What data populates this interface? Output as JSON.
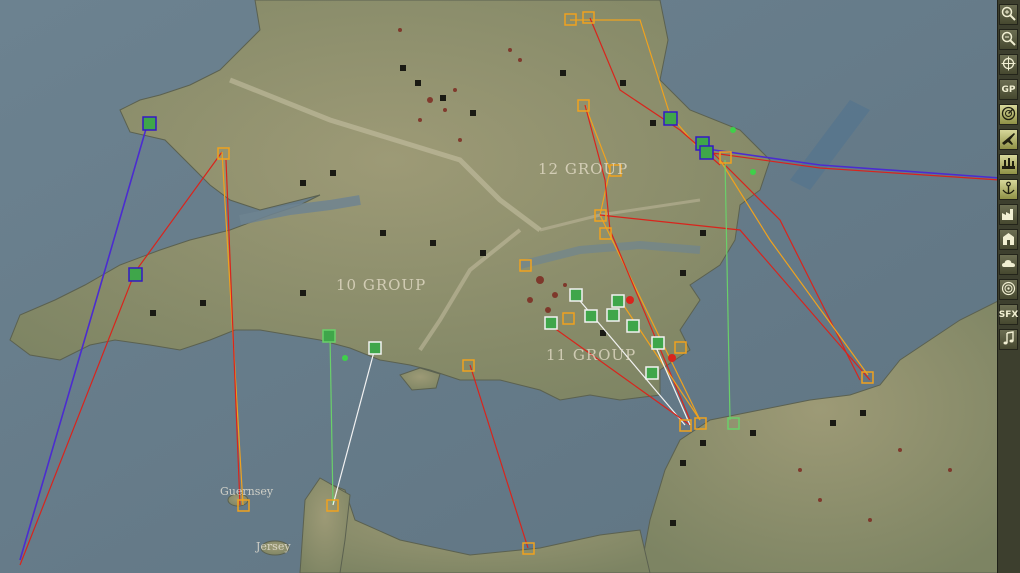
{
  "map": {
    "labels": {
      "group_12": "12 GROUP",
      "group_10": "10 GROUP",
      "group_11": "11 GROUP",
      "guernsey": "Guernsey",
      "jersey": "Jersey"
    },
    "colors": {
      "sea": "#6f8490",
      "land": "#8f9370",
      "route_red": "#d9241c",
      "route_orange": "#f0a21e",
      "route_blue": "#4b2cd0",
      "route_white": "#f2f2f2",
      "route_green": "#6ad06a"
    }
  },
  "toolbar": {
    "buttons": [
      {
        "name": "zoom-in-button",
        "icon": "magnifier-plus-icon",
        "label": ""
      },
      {
        "name": "zoom-out-button",
        "icon": "magnifier-minus-icon",
        "label": ""
      },
      {
        "name": "center-map-button",
        "icon": "crosshair-icon",
        "label": ""
      },
      {
        "name": "gp-button",
        "icon": "",
        "label": "GP"
      },
      {
        "name": "radar-filter-button",
        "icon": "radar-icon",
        "label": ""
      },
      {
        "name": "aircraft-filter-button",
        "icon": "aircraft-icon",
        "label": ""
      },
      {
        "name": "airfield-filter-button",
        "icon": "airfield-icon",
        "label": ""
      },
      {
        "name": "port-filter-button",
        "icon": "anchor-icon",
        "label": ""
      },
      {
        "name": "industry-filter-button",
        "icon": "factory-icon",
        "label": ""
      },
      {
        "name": "city-filter-button",
        "icon": "building-icon",
        "label": ""
      },
      {
        "name": "weather-filter-button",
        "icon": "cloud-icon",
        "label": ""
      },
      {
        "name": "target-filter-button",
        "icon": "target-icon",
        "label": ""
      },
      {
        "name": "sfx-button",
        "icon": "",
        "label": "SFX"
      },
      {
        "name": "music-button",
        "icon": "music-note-icon",
        "label": ""
      }
    ]
  }
}
